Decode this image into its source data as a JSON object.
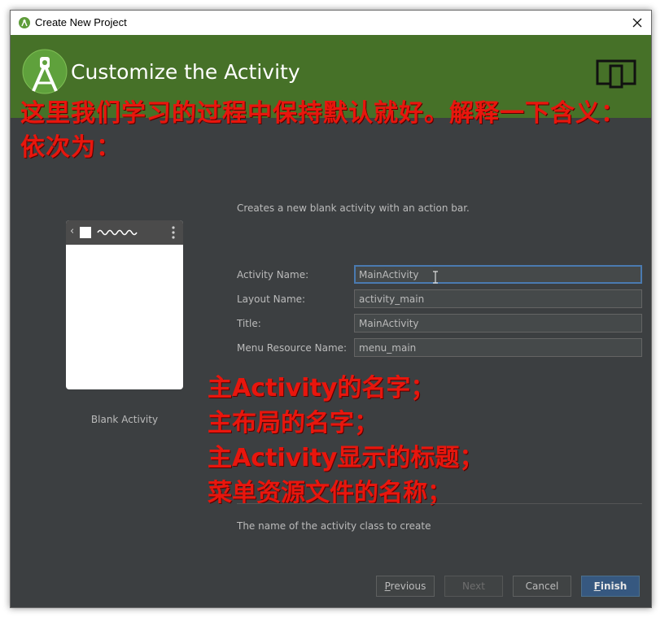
{
  "window": {
    "title": "Create New Project"
  },
  "header": {
    "title": "Customize the Activity"
  },
  "annotation_top": {
    "line1": "这里我们学习的过程中保持默认就好。解释一下含义：",
    "line2": "依次为："
  },
  "annotation_fields": {
    "line1": "主Activity的名字；",
    "line2": "主布局的名字；",
    "line3": "主Activity显示的标题；",
    "line4": "菜单资源文件的名称；"
  },
  "preview": {
    "label": "Blank Activity"
  },
  "description": "Creates a new blank activity with an action bar.",
  "form": {
    "activity_name": {
      "label": "Activity Name:",
      "value": "MainActivity"
    },
    "layout_name": {
      "label": "Layout Name:",
      "value": "activity_main"
    },
    "title": {
      "label": "Title:",
      "value": "MainActivity"
    },
    "menu_resource_name": {
      "label": "Menu Resource Name:",
      "value": "menu_main"
    }
  },
  "hint": "The name of the activity class to create",
  "buttons": {
    "previous": {
      "mnemonic": "P",
      "rest": "revious"
    },
    "next": "Next",
    "cancel": "Cancel",
    "finish": {
      "mnemonic": "F",
      "rest": "inish"
    }
  },
  "colors": {
    "header_bg": "#467128",
    "dialog_bg": "#3c3f41",
    "annotation_red": "#e8160d",
    "primary_button": "#365880",
    "focus_border": "#4a7ab0"
  },
  "icons": [
    "android-studio-icon",
    "close-icon",
    "android-logo-icon",
    "device-icon",
    "text-cursor-icon"
  ]
}
